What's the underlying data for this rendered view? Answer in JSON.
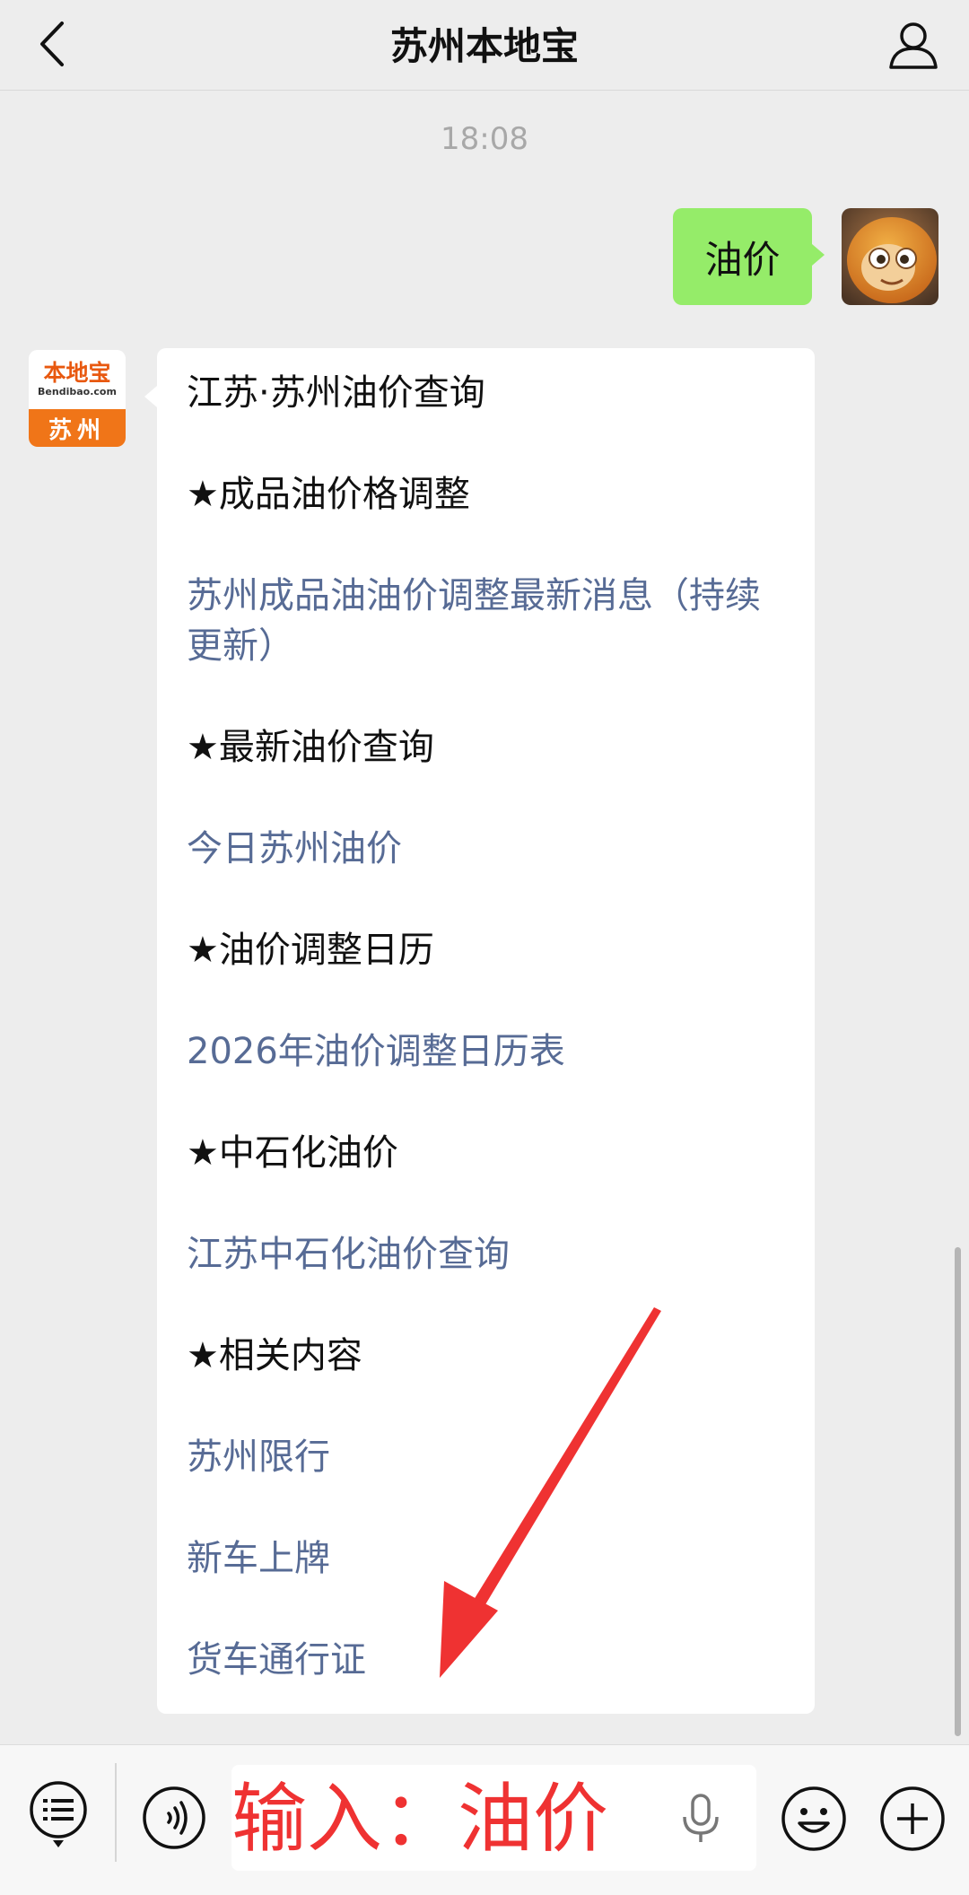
{
  "header": {
    "title": "苏州本地宝",
    "back_icon": "chevron-left-icon",
    "profile_icon": "person-icon"
  },
  "conversation": {
    "timestamp": "18:08",
    "user_message": "油价",
    "bot_avatar": {
      "logo_text": "本地宝",
      "domain_text": "Bendibao.com",
      "city": "苏州"
    },
    "reply_lines": [
      {
        "text": "江苏·苏州油价查询",
        "kind": "heading"
      },
      {
        "text": "★成品油价格调整",
        "kind": "heading"
      },
      {
        "text": "苏州成品油油价调整最新消息（持续更新）",
        "kind": "link"
      },
      {
        "text": "★最新油价查询",
        "kind": "heading"
      },
      {
        "text": "今日苏州油价",
        "kind": "link"
      },
      {
        "text": "★油价调整日历",
        "kind": "heading"
      },
      {
        "text": "2026年油价调整日历表",
        "kind": "link"
      },
      {
        "text": "★中石化油价",
        "kind": "heading"
      },
      {
        "text": "江苏中石化油价查询",
        "kind": "link"
      },
      {
        "text": "★相关内容",
        "kind": "heading"
      },
      {
        "text": "苏州限行",
        "kind": "link"
      },
      {
        "text": "新车上牌",
        "kind": "link"
      },
      {
        "text": "货车通行证",
        "kind": "link"
      }
    ]
  },
  "input_bar": {
    "typed_text": "输入：油价",
    "menu_icon": "menu-list-icon",
    "voice_icon": "voice-icon",
    "mic_icon": "microphone-icon",
    "emoji_icon": "emoji-icon",
    "plus_icon": "plus-icon"
  },
  "colors": {
    "background": "#ededed",
    "user_bubble": "#95ec69",
    "link": "#576b95",
    "annotation_red": "#ef3232",
    "brand_orange": "#f07518"
  }
}
